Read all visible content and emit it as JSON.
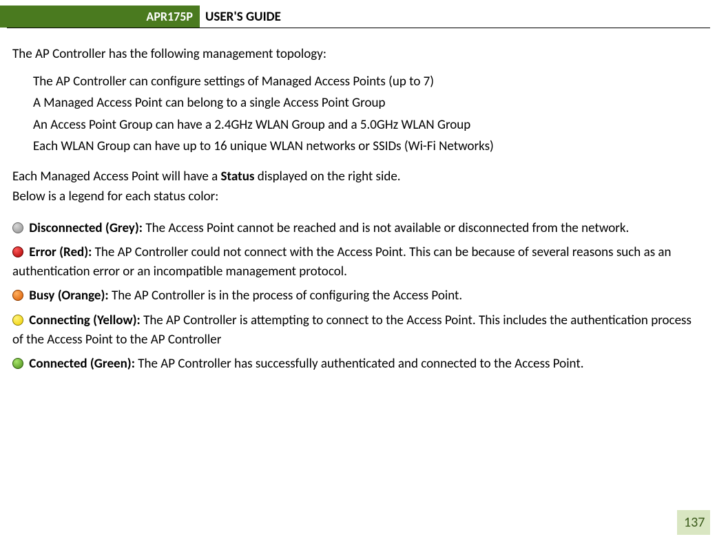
{
  "header": {
    "model": "APR175P",
    "title": "USER'S GUIDE"
  },
  "intro": "The AP Controller has the following management topology:",
  "topology": [
    "The AP Controller can configure settings of Managed Access Points (up to 7)",
    "A Managed Access Point can belong to a single Access Point Group",
    "An Access Point Group can have a 2.4GHz WLAN Group and a 5.0GHz WLAN Group",
    "Each WLAN Group can have up to 16 unique WLAN networks or SSIDs  (Wi-Fi Networks)"
  ],
  "status_intro1_pre": "Each Managed Access Point will have a ",
  "status_intro1_bold": "Status",
  "status_intro1_post": " displayed on the right side.",
  "status_intro2": "Below is a legend for each status color:",
  "legend": [
    {
      "dot": "dot-grey",
      "label": "Disconnected (Grey): ",
      "text": "The Access Point cannot be reached and is not available or disconnected from the network."
    },
    {
      "dot": "dot-red",
      "label": "Error (Red): ",
      "text": "The AP Controller could not connect with the Access Point.  This can be because of several reasons such as an authentication error or an incompatible management protocol."
    },
    {
      "dot": "dot-orange",
      "label": "Busy (Orange): ",
      "text": "The AP Controller is in the process of configuring the Access Point."
    },
    {
      "dot": "dot-yellow",
      "label": "Connecting (Yellow): ",
      "text": "The AP Controller is attempting to connect to the Access Point.  This includes the authentication process of the Access Point to the AP Controller"
    },
    {
      "dot": "dot-green",
      "label": "Connected (Green): ",
      "text": "The AP Controller has successfully authenticated and connected to the Access Point."
    }
  ],
  "page_number": "137"
}
